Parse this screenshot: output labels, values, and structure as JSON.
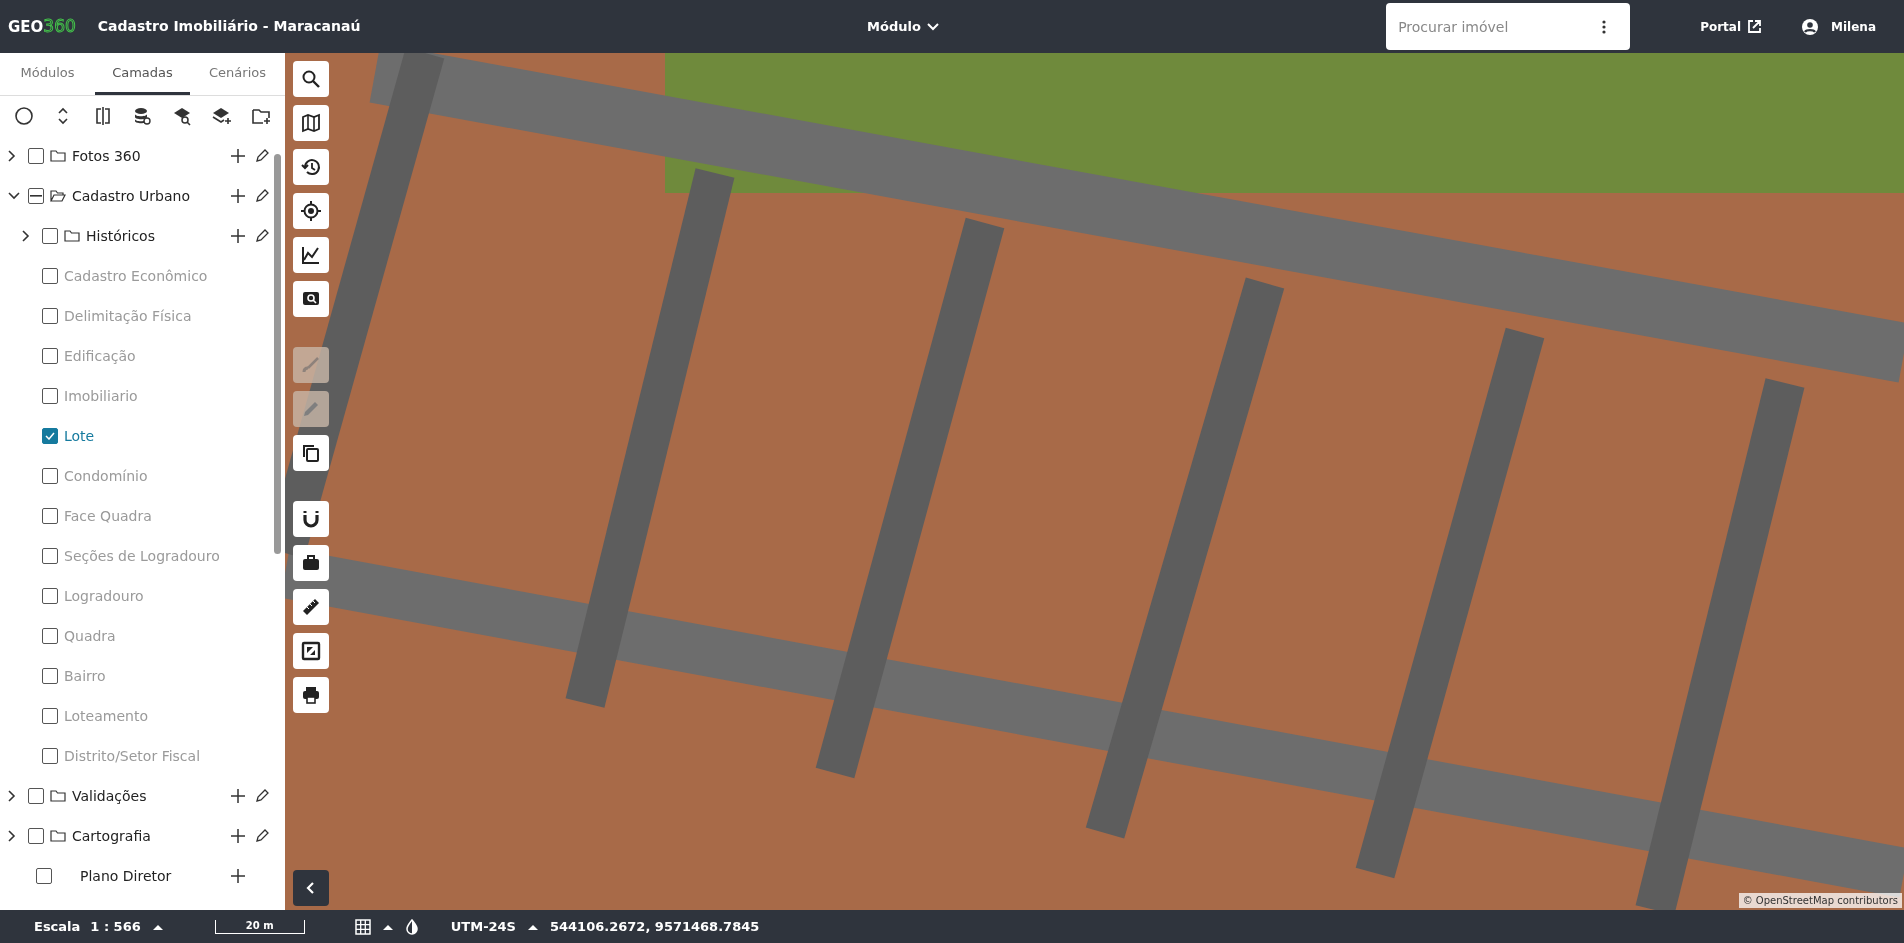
{
  "header": {
    "logo": {
      "part_1": "GEO",
      "part_2": "360"
    },
    "title": "Cadastro Imobiliário - Maracanaú",
    "module_menu": "Módulo",
    "search": {
      "placeholder": "Procurar imóvel"
    },
    "portal_link": "Portal",
    "user": "Milena"
  },
  "sidebar": {
    "tabs": [
      {
        "label": "Módulos",
        "selected": false
      },
      {
        "label": "Camadas",
        "selected": true
      },
      {
        "label": "Cenários",
        "selected": false
      }
    ],
    "tree": [
      {
        "label": "Fotos 360",
        "kind": "folder",
        "expanded": false,
        "checked": false,
        "indeterminate": false
      },
      {
        "label": "Cadastro Urbano",
        "kind": "folder",
        "expanded": true,
        "indeterminate": true,
        "children": [
          {
            "label": "Históricos",
            "kind": "folder",
            "expanded": false,
            "checked": false,
            "indeterminate": false
          },
          {
            "label": "Cadastro Econômico",
            "kind": "layer",
            "checked": false
          },
          {
            "label": "Delimitação Física",
            "kind": "layer",
            "checked": false
          },
          {
            "label": "Edificação",
            "kind": "layer",
            "checked": false
          },
          {
            "label": "Imobiliario",
            "kind": "layer",
            "checked": false
          },
          {
            "label": "Lote",
            "kind": "layer",
            "checked": true
          },
          {
            "label": "Condomínio",
            "kind": "layer",
            "checked": false
          },
          {
            "label": "Face Quadra",
            "kind": "layer",
            "checked": false
          },
          {
            "label": "Seções de Logradouro",
            "kind": "layer",
            "checked": false
          },
          {
            "label": "Logradouro",
            "kind": "layer",
            "checked": false
          },
          {
            "label": "Quadra",
            "kind": "layer",
            "checked": false
          },
          {
            "label": "Bairro",
            "kind": "layer",
            "checked": false
          },
          {
            "label": "Loteamento",
            "kind": "layer",
            "checked": false
          },
          {
            "label": "Distrito/Setor Fiscal",
            "kind": "layer",
            "checked": false
          }
        ]
      },
      {
        "label": "Validações",
        "kind": "folder",
        "expanded": false,
        "checked": false,
        "indeterminate": false
      },
      {
        "label": "Cartografia",
        "kind": "folder",
        "expanded": false,
        "checked": false,
        "indeterminate": false
      },
      {
        "label": "Plano Diretor",
        "kind": "group",
        "checked": false
      }
    ]
  },
  "map": {
    "tools": [
      {
        "kind": "search",
        "disabled": false
      },
      {
        "kind": "map",
        "disabled": false
      },
      {
        "kind": "history",
        "disabled": false
      },
      {
        "kind": "locate",
        "disabled": false
      },
      {
        "kind": "chart",
        "disabled": false
      },
      {
        "kind": "zoom-box",
        "disabled": false
      },
      {
        "kind": "brush",
        "disabled": true
      },
      {
        "kind": "pencil",
        "disabled": true
      },
      {
        "kind": "copy",
        "disabled": false
      },
      {
        "kind": "magnet",
        "disabled": false
      },
      {
        "kind": "briefcase",
        "disabled": false
      },
      {
        "kind": "ruler",
        "disabled": false
      },
      {
        "kind": "extent",
        "disabled": false
      },
      {
        "kind": "print",
        "disabled": false
      }
    ],
    "attribution": "© OpenStreetMap contributors"
  },
  "status_bar": {
    "scale_label": "Escala",
    "scale": "1 : 566",
    "scale_bar": "20 m",
    "projection": "UTM-24S",
    "coordinates": "544106.2672, 9571468.7845"
  }
}
